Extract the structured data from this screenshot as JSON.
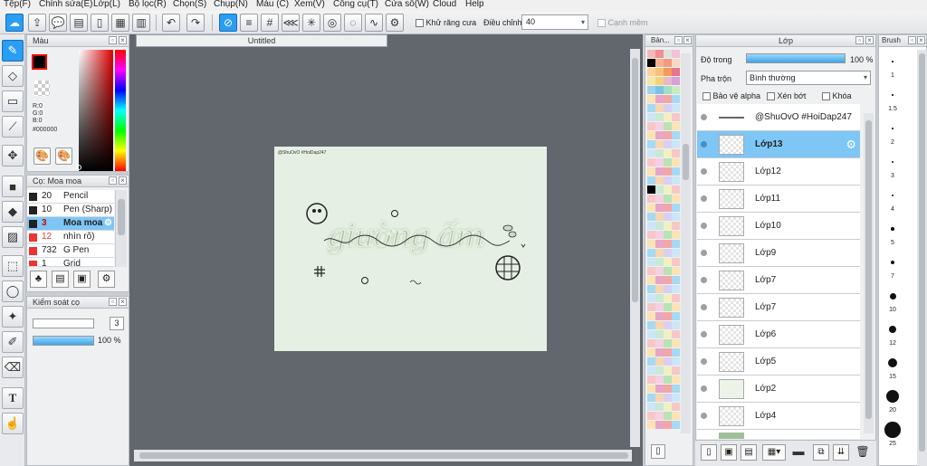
{
  "menu": [
    "Tệp(F)",
    "Chỉnh sửa(E)",
    "Lớp(L)",
    "Bộ lọc(R)",
    "Chọn(S)",
    "Chụp(N)",
    "Màu (C)",
    "Xem(V)",
    "Công cụ(T)",
    "Cửa sổ(W)",
    "Cloud",
    "Help"
  ],
  "toolbar": {
    "antialias_label": "Khử răng cưa",
    "adjust_label": "Điều chỉnh",
    "adjust_value": "40",
    "edge_label": "Cạnh mềm"
  },
  "color_panel": {
    "title": "Màu",
    "r": "R:0",
    "g": "G:0",
    "b": "B:0",
    "hex": "#000000",
    "primary_color": "#000000"
  },
  "brush_panel": {
    "title": "Cọ: Moa moa",
    "items": [
      {
        "size": "20",
        "name": "Pencil"
      },
      {
        "size": "10",
        "name": "Pen (Sharp)"
      },
      {
        "size": "3",
        "name": "Moa moa"
      },
      {
        "size": "12",
        "name": "nhìn rõ)"
      },
      {
        "size": "732",
        "name": "G Pen"
      },
      {
        "size": "1",
        "name": "Grid"
      }
    ]
  },
  "brush_control": {
    "title": "Kiểm soát cọ",
    "size_value": "3",
    "opacity_value": "100 %"
  },
  "document": {
    "tab_title": "Untitled",
    "watermark": "@ShuOvO #HoiDap247",
    "artwork_text": "giường ấm"
  },
  "palette_panel": {
    "title": "Bản..."
  },
  "layer_panel": {
    "title": "Lớp",
    "opacity_label": "Độ trong",
    "opacity_value": "100 %",
    "blend_label": "Pha trộn",
    "blend_value": "Bình thường",
    "protect_alpha": "Bảo vệ alpha",
    "clipping": "Xén bớt",
    "lock": "Khóa",
    "layers": [
      "@ShuOvO #HoiDap247",
      "Lớp13",
      "Lớp12",
      "Lớp11",
      "Lớp10",
      "Lớp9",
      "Lớp7",
      "Lớp7",
      "Lớp6",
      "Lớp5",
      "Lớp2",
      "Lớp4"
    ]
  },
  "brush_size_panel": {
    "title": "Brush",
    "sizes": [
      "1",
      "1.5",
      "2",
      "3",
      "4",
      "5",
      "7",
      "10",
      "12",
      "15",
      "20",
      "25"
    ]
  },
  "colors": {
    "accent": "#2a9df4",
    "selected_layer": "#7dc6f5"
  }
}
